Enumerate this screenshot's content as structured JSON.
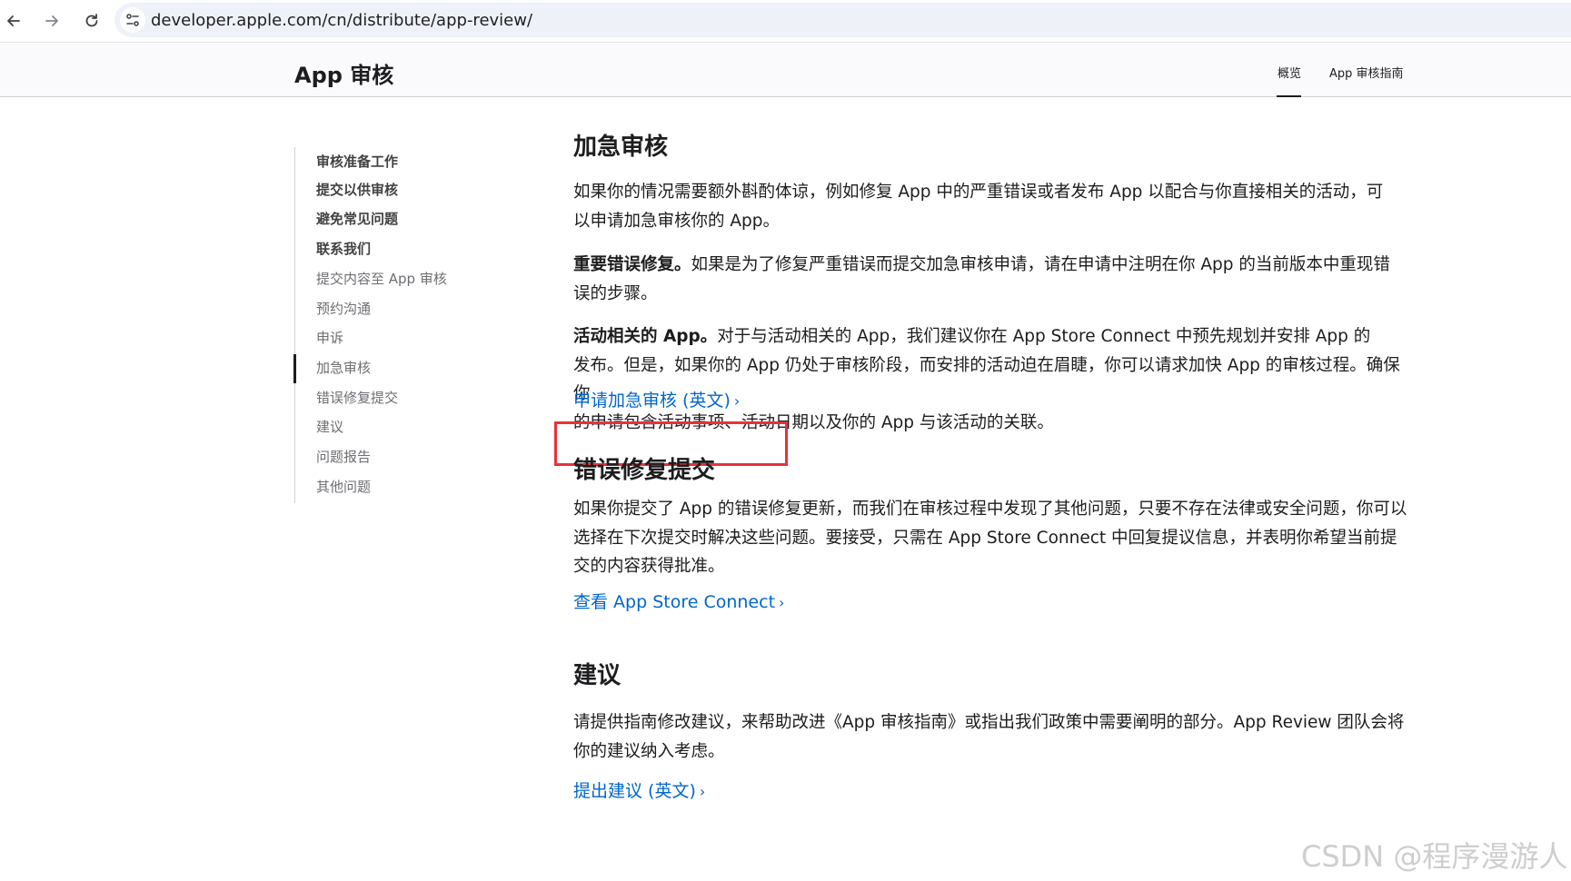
{
  "browser": {
    "url": "developer.apple.com/cn/distribute/app-review/"
  },
  "local_nav": {
    "title": "App 审核",
    "links": [
      "概览",
      "App 审核指南"
    ]
  },
  "sidebar": {
    "items": [
      {
        "label": "审核准备工作"
      },
      {
        "label": "提交以供审核"
      },
      {
        "label": "避免常见问题"
      },
      {
        "label": "联系我们"
      },
      {
        "label": "提交内容至 App 审核"
      },
      {
        "label": "预约沟通"
      },
      {
        "label": "申诉"
      },
      {
        "label": "加急审核"
      },
      {
        "label": "错误修复提交"
      },
      {
        "label": "建议"
      },
      {
        "label": "问题报告"
      },
      {
        "label": "其他问题"
      }
    ]
  },
  "sections": {
    "expedite": {
      "heading": "加急审核",
      "p1_line1": "如果你的情况需要额外斟酌体谅，例如修复 App 中的严重错误或者发布 App 以配合与你直接相关的活动，可",
      "p1_line2": "以申请加急审核你的 App。",
      "p2_bold": "重要错误修复。",
      "p2_line1": "如果是为了修复严重错误而提交加急审核申请，请在申请中注明在你 App 的当前版本中重现错",
      "p2_line2": "误的步骤。",
      "p3_bold": "活动相关的 App。",
      "p3_line1": "对于与活动相关的 App，我们建议你在 App Store Connect 中预先规划并安排 App 的",
      "p3_line2": "发布。但是，如果你的 App 仍处于审核阶段，而安排的活动迫在眉睫，你可以请求加快 App 的审核过程。确保你",
      "p3_line3": "的申请包含活动事项、活动日期以及你的 App 与该活动的关联。",
      "link": "申请加急审核 (英文)",
      "link_chevron": "›"
    },
    "bugfix": {
      "heading": "错误修复提交",
      "p_line1": "如果你提交了 App 的错误修复更新，而我们在审核过程中发现了其他问题，只要不存在法律或安全问题，你可以",
      "p_line2": "选择在下次提交时解决这些问题。要接受，只需在 App Store Connect 中回复提议信息，并表明你希望当前提",
      "p_line3": "交的内容获得批准。",
      "link": "查看 App Store Connect",
      "link_chevron": "›"
    },
    "suggestions": {
      "heading": "建议",
      "p_line1": "请提供指南修改建议，来帮助改进《App 审核指南》或指出我们政策中需要阐明的部分。App Review 团队会将",
      "p_line2": "你的建议纳入考虑。",
      "link": "提出建议 (英文)",
      "link_chevron": "›"
    }
  },
  "watermark": "CSDN @程序漫游人",
  "colors": {
    "link": "#0066cc",
    "highlight": "#e8313c",
    "text": "#1d1d1f",
    "muted": "#6e6e73"
  }
}
